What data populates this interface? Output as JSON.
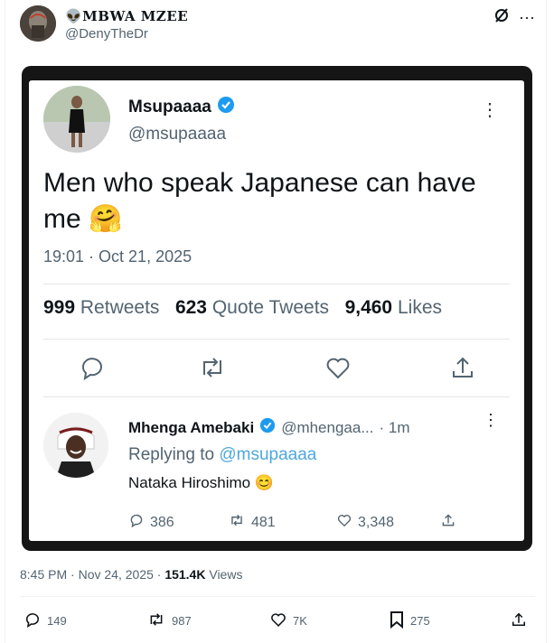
{
  "post": {
    "author_name": "👽MBWA MZEE",
    "author_handle": "@DenyTheDr",
    "posted_time": "8:45 PM · Nov 24, 2025 · ",
    "views_count": "151.4K",
    "views_label": " Views"
  },
  "quoted": {
    "name": "Msupaaaa",
    "handle": "@msupaaaa",
    "text": "Men who speak Japanese can have me 🤗",
    "time": "19:01 · Oct 21, 2025",
    "retweets_count": "999",
    "retweets_label": "Retweets",
    "quotes_count": "623",
    "quotes_label": "Quote Tweets",
    "likes_count": "9,460",
    "likes_label": "Likes"
  },
  "reply": {
    "name": "Mhenga Amebaki",
    "handle": "@mhengaa...",
    "time": "· 1m",
    "replying_prefix": "Replying to ",
    "replying_handle": "@msupaaaa",
    "text": "Nataka Hiroshimo 😊",
    "replies": "386",
    "retweets": "481",
    "likes": "3,348"
  },
  "actions": {
    "replies": "149",
    "reposts": "987",
    "likes": "7K",
    "bookmarks": "275"
  },
  "icons": [
    "grok-icon",
    "more-icon",
    "reply-icon",
    "retweet-icon",
    "like-icon",
    "share-icon",
    "bookmark-icon",
    "verified-icon"
  ],
  "colors": {
    "verified": "#1d9bf0",
    "link": "#4ea8de",
    "frame": "#151515"
  }
}
